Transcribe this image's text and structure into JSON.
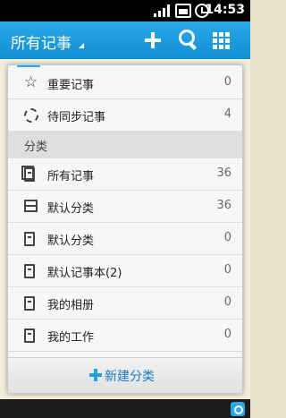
{
  "status_bar": {
    "time": "14:53"
  },
  "action_bar": {
    "title": "所有记事"
  },
  "menu": {
    "top_items": [
      {
        "label": "重要记事",
        "count": "0",
        "icon": "star-icon"
      },
      {
        "label": "待同步记事",
        "count": "4",
        "icon": "sync-icon"
      }
    ],
    "section_title": "分类",
    "categories": [
      {
        "label": "所有记事",
        "count": "36",
        "icon": "documents-icon"
      },
      {
        "label": "默认分类",
        "count": "36",
        "icon": "archive-icon"
      },
      {
        "label": "默认分类",
        "count": "0",
        "icon": "notebook-icon"
      },
      {
        "label": "默认记事本(2)",
        "count": "0",
        "icon": "notebook-icon"
      },
      {
        "label": "我的相册",
        "count": "0",
        "icon": "notebook-icon"
      },
      {
        "label": "我的工作",
        "count": "0",
        "icon": "notebook-icon"
      }
    ],
    "new_category_label": "新建分类"
  }
}
